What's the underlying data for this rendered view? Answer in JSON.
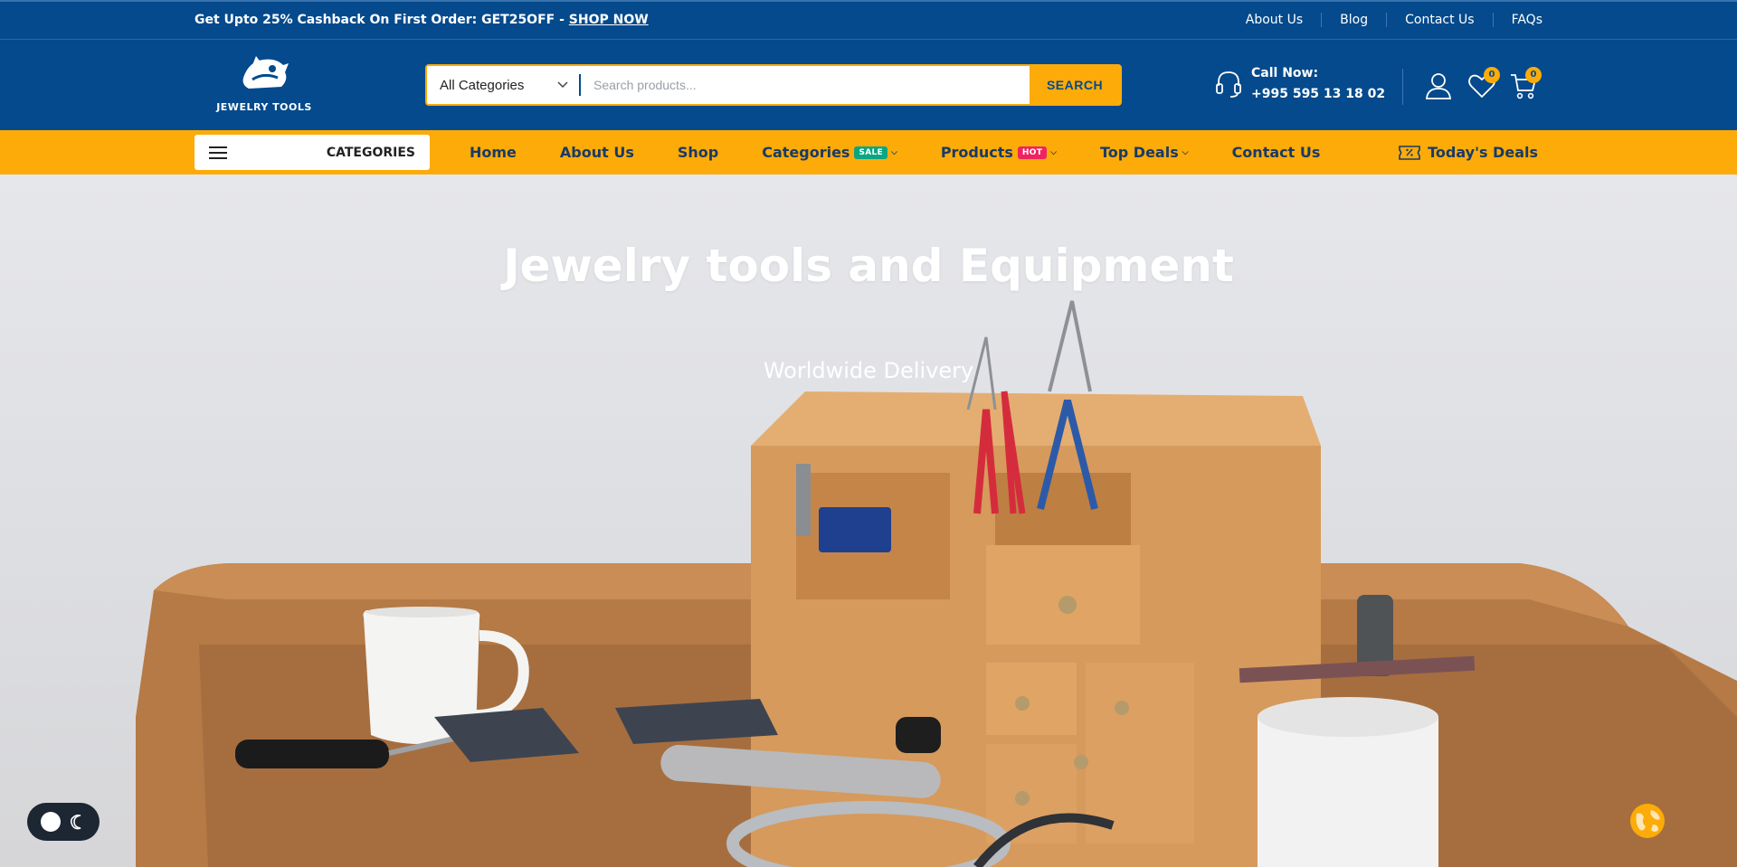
{
  "topbar": {
    "promo_text": "Get Upto 25% Cashback On First Order: GET25OFF - ",
    "promo_link": "SHOP NOW",
    "links": [
      "About Us",
      "Blog",
      "Contact Us",
      "FAQs"
    ]
  },
  "header": {
    "logo_text": "JEWELRY TOOLS",
    "search": {
      "category": "All Categories",
      "placeholder": "Search products...",
      "button": "SEARCH"
    },
    "call": {
      "label": "Call Now:",
      "phone": "+995 595 13 18 02"
    },
    "wishlist_count": "0",
    "cart_count": "0"
  },
  "nav": {
    "categories_button": "CATEGORIES",
    "items": [
      "Home",
      "About Us",
      "Shop",
      "Categories",
      "Products",
      "Top Deals",
      "Contact Us"
    ],
    "sale_badge": "SALE",
    "hot_badge": "HOT",
    "deals": "Today's Deals"
  },
  "hero": {
    "title": "Jewelry tools and Equipment",
    "subtitle": "Worldwide Delivery"
  },
  "colors": {
    "primary": "#044a8c",
    "accent": "#fcab08",
    "sale": "#0aa683",
    "hot": "#ee2460"
  },
  "icons": [
    "menu-icon",
    "headset-icon",
    "user-icon",
    "heart-icon",
    "cart-icon",
    "ticket-icon",
    "moon-icon",
    "globe-icon"
  ]
}
